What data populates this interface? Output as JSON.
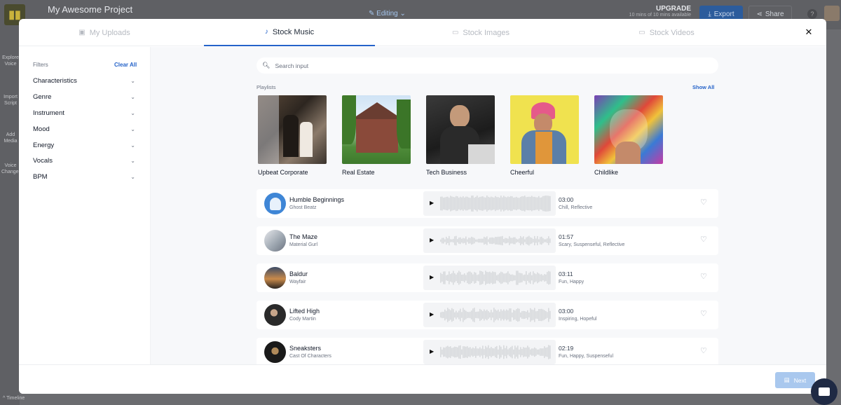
{
  "app": {
    "project_title": "My Awesome Project",
    "editing_label": "Editing",
    "upgrade_label": "UPGRADE",
    "upgrade_sub": "10 mins of 10 mins available",
    "export_label": "Export",
    "share_label": "Share",
    "help_label": "?",
    "rail": {
      "explore": "Explore Voice",
      "import": "Import Script",
      "add_media": "Add Media",
      "voice_changer": "Voice Changer"
    },
    "timeline_label": "Timeline"
  },
  "tabs": [
    {
      "label": "My Uploads",
      "icon": "folder-icon",
      "active": false
    },
    {
      "label": "Stock Music",
      "icon": "music-note-icon",
      "active": true
    },
    {
      "label": "Stock Images",
      "icon": "image-icon",
      "active": false
    },
    {
      "label": "Stock Videos",
      "icon": "video-icon",
      "active": false
    }
  ],
  "filters": {
    "title": "Filters",
    "clear_all": "Clear All",
    "items": [
      "Characteristics",
      "Genre",
      "Instrument",
      "Mood",
      "Energy",
      "Vocals",
      "BPM"
    ]
  },
  "search": {
    "placeholder": "Search input"
  },
  "playlists": {
    "label": "Playlists",
    "show_all": "Show All",
    "items": [
      "Upbeat Corporate",
      "Real Estate",
      "Tech Business",
      "Cheerful",
      "Childlike"
    ]
  },
  "tracks": [
    {
      "title": "Humble Beginnings",
      "artist": "Ghost Beatz",
      "duration": "03:00",
      "tags": "Chill, Reflective"
    },
    {
      "title": "The Maze",
      "artist": "Material Gurl",
      "duration": "01:57",
      "tags": "Scary, Suspenseful, Reflective"
    },
    {
      "title": "Baldur",
      "artist": "Wayfair",
      "duration": "03:11",
      "tags": "Fun, Happy"
    },
    {
      "title": "Lifted High",
      "artist": "Cody Martin",
      "duration": "03:00",
      "tags": "Inspiring, Hopeful"
    },
    {
      "title": "Sneaksters",
      "artist": "Cast Of Characters",
      "duration": "02:19",
      "tags": "Fun, Happy, Suspenseful"
    }
  ],
  "footer": {
    "next_label": "Next"
  },
  "colors": {
    "accent": "#2563c9",
    "next_disabled": "#a9c8ee"
  }
}
